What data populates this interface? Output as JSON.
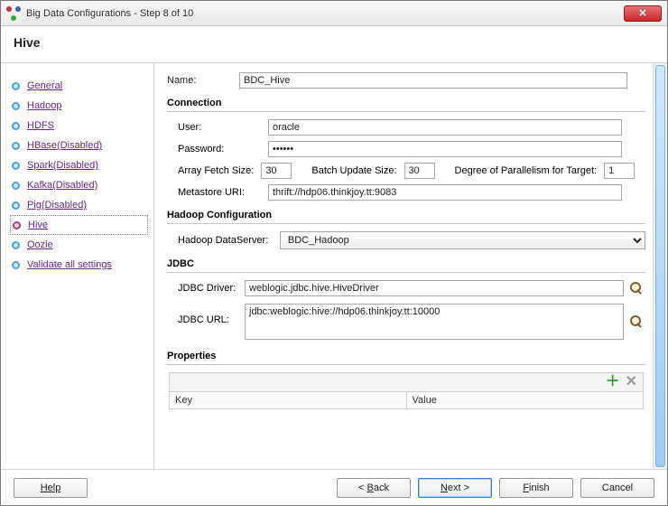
{
  "window": {
    "title": "Big Data Configurations - Step 8 of 10",
    "close_glyph": "✕"
  },
  "page_heading": "Hive",
  "sidebar": {
    "items": [
      {
        "label": "General"
      },
      {
        "label": "Hadoop"
      },
      {
        "label": "HDFS"
      },
      {
        "label": "HBase(Disabled)"
      },
      {
        "label": "Spark(Disabled)"
      },
      {
        "label": "Kafka(Disabled)"
      },
      {
        "label": "Pig(Disabled)"
      },
      {
        "label": "Hive"
      },
      {
        "label": "Oozie"
      },
      {
        "label": "Validate all settings"
      }
    ],
    "active_index": 7
  },
  "form": {
    "name_label": "Name:",
    "name_value": "BDC_Hive",
    "connection_title": "Connection",
    "user_label": "User:",
    "user_value": "oracle",
    "password_label": "Password:",
    "password_value": "••••••",
    "array_fetch_label": "Array Fetch Size:",
    "array_fetch_value": "30",
    "batch_update_label": "Batch Update Size:",
    "batch_update_value": "30",
    "parallel_label": "Degree of Parallelism for Target:",
    "parallel_value": "1",
    "metastore_label": "Metastore URI:",
    "metastore_value": "thrift://hdp06.thinkjoy.tt:9083",
    "hadoop_title": "Hadoop Configuration",
    "hadoop_ds_label": "Hadoop DataServer:",
    "hadoop_ds_value": "BDC_Hadoop",
    "jdbc_title": "JDBC",
    "jdbc_driver_label": "JDBC Driver:",
    "jdbc_driver_value": "weblogic.jdbc.hive.HiveDriver",
    "jdbc_url_label": "JDBC URL:",
    "jdbc_url_value": "jdbc:weblogic:hive://hdp06.thinkjoy.tt:10000",
    "properties_title": "Properties",
    "prop_col_key": "Key",
    "prop_col_value": "Value"
  },
  "footer": {
    "help": "Help",
    "back": "ack",
    "back_u": "B",
    "back_prefix": "< ",
    "next": "ext >",
    "next_u": "N",
    "finish": "inish",
    "finish_u": "F",
    "cancel": "Cancel"
  }
}
